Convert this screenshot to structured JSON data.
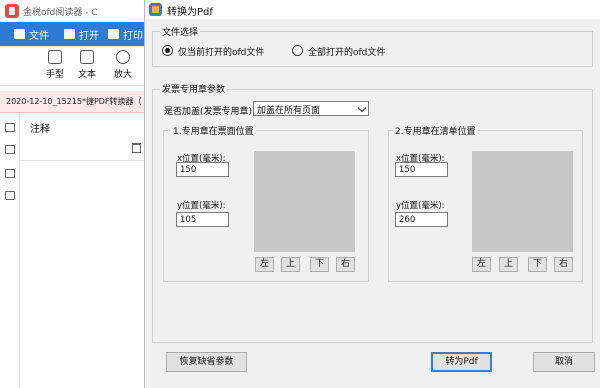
{
  "bg_app": {
    "title": "金税ofd阅读器",
    "title_suffix": "- C",
    "menu": [
      {
        "label": "文件",
        "icon": "menu-icon"
      },
      {
        "label": "打开",
        "icon": "folder-icon"
      },
      {
        "label": "打印",
        "icon": "printer-icon"
      }
    ],
    "tools": [
      {
        "label": "手型",
        "icon": "hand-icon"
      },
      {
        "label": "文本",
        "icon": "text-icon"
      },
      {
        "label": "放大",
        "icon": "zoom-in-icon"
      }
    ],
    "doc_tab": "2020-12-10_15215*捷PDF转换器（",
    "notes_title": "注释"
  },
  "dialog": {
    "title": "转换为Pdf",
    "file_select": {
      "label": "文件选择",
      "option_current": "仅当前打开的ofd文件",
      "option_all": "全部打开的ofd文件",
      "selected": "current"
    },
    "stamp_params": {
      "label": "发票专用章参数",
      "apply_label": "是否加盖(发票专用章)",
      "apply_value": "加盖在所有页面"
    },
    "front_pos": {
      "label": "1.专用章在票面位置",
      "x_label": "x位置(毫米):",
      "x_value": "150",
      "y_label": "y位置(毫米):",
      "y_value": "105"
    },
    "list_pos": {
      "label": "2.专用章在清单位置",
      "x_label": "x位置(毫米):",
      "x_value": "150",
      "y_label": "y位置(毫米):",
      "y_value": "260"
    },
    "nudge": {
      "left": "左",
      "up": "上",
      "down": "下",
      "right": "右"
    },
    "buttons": {
      "restore": "恢复缺省参数",
      "convert": "转为Pdf",
      "cancel": "取消"
    }
  }
}
